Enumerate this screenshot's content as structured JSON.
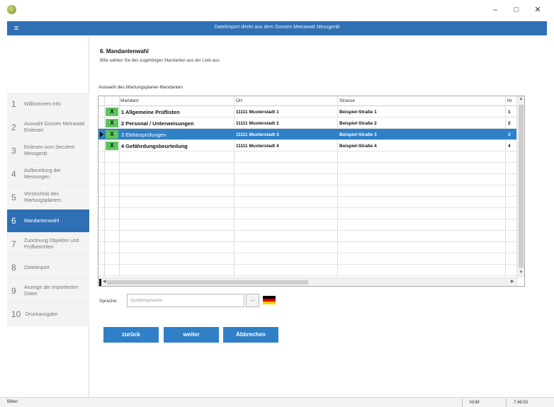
{
  "window": {
    "minimize": "–",
    "maximize": "□",
    "close": "✕"
  },
  "header": {
    "menu_icon": "≡",
    "title": "Dateiimport direkt aus dem Gossen Metrawatt Messgerät"
  },
  "sidebar": {
    "items": [
      {
        "num": "1",
        "label": "Willkommen Info"
      },
      {
        "num": "2",
        "label": "Auswahl Gossen Metrawatt Einlesart"
      },
      {
        "num": "3",
        "label": "Einlesen vom Secutest Messgerät"
      },
      {
        "num": "4",
        "label": "Aufbereitung der Messungen"
      },
      {
        "num": "5",
        "label": "Verzeichnis des Wartungsplaners"
      },
      {
        "num": "6",
        "label": "Mandantenwahl"
      },
      {
        "num": "7",
        "label": "Zuordnung Objekten und Prüfberichten"
      },
      {
        "num": "8",
        "label": "Dateiimport"
      },
      {
        "num": "9",
        "label": "Anzeige der importierten Daten"
      },
      {
        "num": "10",
        "label": "Druckausgabe"
      }
    ]
  },
  "main": {
    "title": "6. Mandantenwahl",
    "subtitle": "Bitte wählen Sie den zugehörigen Mandanten aus der Liste aus.",
    "grid_caption": "Auswahl des Wartungsplaner-Mandanten",
    "columns": [
      "Mandant",
      "Ort",
      "Strasse",
      "Nr"
    ],
    "rows": [
      {
        "flag": "X",
        "mandant": "1 Allgemeine Prüflisten",
        "ort": "11111 Musterstadt 1",
        "strasse": "Beispiel-Straße 1",
        "nr": "1"
      },
      {
        "flag": "X",
        "mandant": "2 Personal / Unterweisungen",
        "ort": "11111 Musterstadt 2",
        "strasse": "Beispiel-Straße 2",
        "nr": "2"
      },
      {
        "flag": "X",
        "mandant": "3 Elektroprüfungen",
        "ort": "11111 Musterstadt 3",
        "strasse": "Beispiel-Straße 3",
        "nr": "3"
      },
      {
        "flag": "X",
        "mandant": "4 Gefährdungsbeurteilung",
        "ort": "11111 Musterstadt 4",
        "strasse": "Beispiel-Straße 4",
        "nr": "4"
      }
    ],
    "language_label": "Sprache:",
    "language_value": "Systemsprache",
    "language_button": "...",
    "buttons": {
      "back": "zurück",
      "next": "weiter",
      "cancel": "Abbrechen"
    },
    "flag_colors": [
      "#000000",
      "#dd0000",
      "#ffce00"
    ]
  },
  "status": {
    "left": "Bitten",
    "num": "NUM",
    "time": "7:46:53"
  }
}
